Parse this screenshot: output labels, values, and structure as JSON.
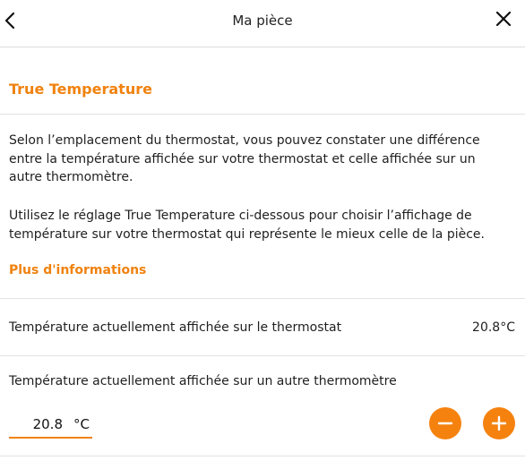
{
  "header": {
    "title": "Ma pièce",
    "back_icon": "chevron-left-icon",
    "close_icon": "close-icon"
  },
  "section": {
    "title": "True Temperature"
  },
  "description": {
    "paragraph1": "Selon l’emplacement du thermostat, vous pouvez constater une différence entre la température affichée sur votre thermostat et celle affichée sur un autre thermomètre.",
    "paragraph2": "Utilisez le réglage True Temperature ci-dessous pour choisir l’affichage de température sur votre thermostat qui représente le mieux celle de la pièce.",
    "more_info_link": "Plus d'informations"
  },
  "thermostat_row": {
    "label": "Température actuellement affichée sur le thermostat",
    "value": "20.8°C"
  },
  "other_thermometer": {
    "label": "Température actuellement affichée sur un autre thermomètre",
    "input_value": "20.8",
    "unit": "°C",
    "minus_icon": "minus-icon",
    "plus_icon": "plus-icon"
  },
  "colors": {
    "accent": "#f0820f",
    "text": "#1f1f1f",
    "divider": "#e2e2e2"
  }
}
